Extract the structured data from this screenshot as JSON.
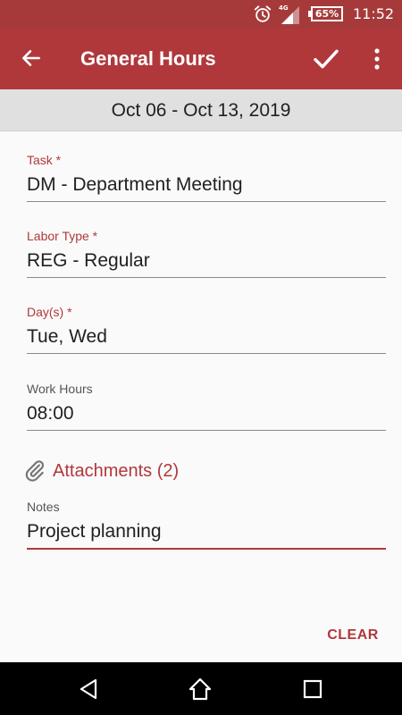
{
  "status_bar": {
    "network_label": "4G",
    "battery": "65%",
    "time": "11:52",
    "icons": [
      "alarm-icon",
      "signal-icon",
      "battery-icon"
    ]
  },
  "app_bar": {
    "title": "General Hours",
    "icons": [
      "back-arrow-icon",
      "check-icon",
      "more-vert-icon"
    ]
  },
  "date_range": "Oct 06 - Oct 13, 2019",
  "form": {
    "task": {
      "label": "Task *",
      "value": "DM - Department Meeting"
    },
    "labor_type": {
      "label": "Labor Type *",
      "value": "REG - Regular"
    },
    "days": {
      "label": "Day(s) *",
      "value": "Tue, Wed"
    },
    "work_hours": {
      "label": "Work Hours",
      "value": "08:00"
    },
    "notes": {
      "label": "Notes",
      "value": "Project planning"
    }
  },
  "attachments": {
    "label": "Attachments (2)",
    "icon": "paperclip-icon"
  },
  "clear_label": "CLEAR",
  "nav_bar": {
    "icons": [
      "nav-back-icon",
      "nav-home-icon",
      "nav-recents-icon"
    ]
  },
  "colors": {
    "primary": "#b0383b",
    "status_bar": "#a63a3a",
    "date_header_bg": "#e0e0e0",
    "text": "#212121"
  }
}
